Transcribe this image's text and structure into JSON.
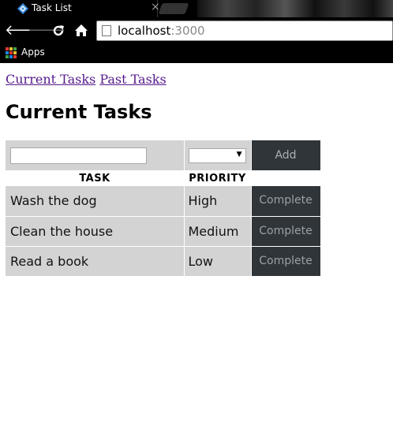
{
  "browser": {
    "tab_title": "Task List",
    "tab_close": "×",
    "url_host": "localhost",
    "url_port": ":3000",
    "bookmarks_apps_label": "Apps",
    "icons": [
      "back-arrow-icon",
      "forward-arrow-icon",
      "reload-icon",
      "home-icon",
      "page-icon",
      "apps-grid-icon",
      "tab-favicon"
    ]
  },
  "nav": {
    "current_link": "Current Tasks",
    "past_link": "Past Tasks"
  },
  "page": {
    "title": "Current Tasks"
  },
  "form": {
    "task_value": "",
    "priority_selected": "",
    "add_label": "Add"
  },
  "table": {
    "headers": [
      "TASK",
      "PRIORITY",
      ""
    ],
    "rows": [
      {
        "task": "Wash the dog",
        "priority": "High",
        "action": "Complete"
      },
      {
        "task": "Clean the house",
        "priority": "Medium",
        "action": "Complete"
      },
      {
        "task": "Read a book",
        "priority": "Low",
        "action": "Complete"
      }
    ]
  },
  "colors": {
    "chrome_bg": "#000000",
    "row_bg": "#d3d3d3",
    "button_bg": "#2f3538",
    "link": "#551a8b"
  }
}
